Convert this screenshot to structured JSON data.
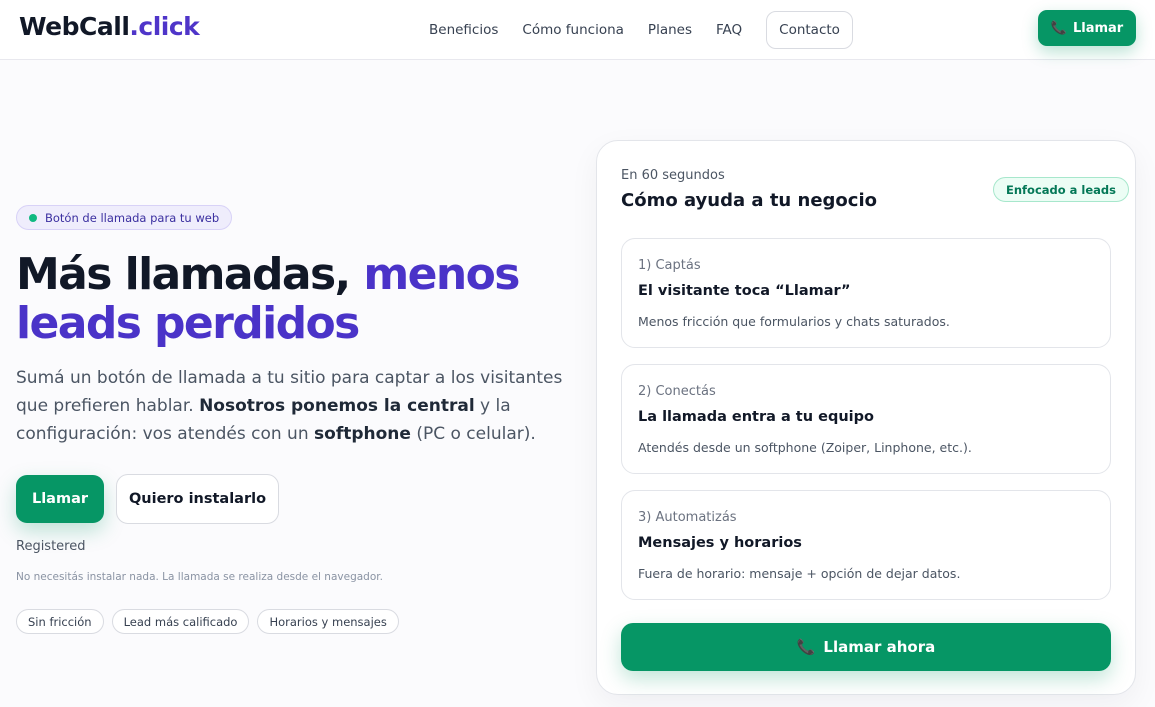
{
  "header": {
    "logo_main": "WebCall",
    "logo_accent": ".click",
    "nav": [
      "Beneficios",
      "Cómo funciona",
      "Planes",
      "FAQ"
    ],
    "contact": "Contacto",
    "call_label": "Llamar",
    "call_icon": "phone-icon"
  },
  "hero": {
    "pill": "Botón de llamada para tu web",
    "title_dark": "Más llamadas,",
    "title_purple": "menos leads perdidos",
    "lead_1": "Sumá un botón de llamada a tu sitio para captar a los visitantes que prefieren hablar. ",
    "lead_bold_1": "Nosotros ponemos la central",
    "lead_2": " y la configuración: vos atendés con un ",
    "lead_bold_2": "softphone",
    "lead_3": " (PC o celular).",
    "cta_call": "Llamar",
    "cta_install": "Quiero instalarlo",
    "status": "Registered",
    "note": "No necesitás instalar nada. La llamada se realiza desde el navegador.",
    "chips": [
      "Sin fricción",
      "Lead más calificado",
      "Horarios y mensajes"
    ]
  },
  "card": {
    "subtitle": "En 60 segundos",
    "title": "Cómo ayuda a tu negocio",
    "badge": "Enfocado a leads",
    "steps": [
      {
        "num": "1) Captás",
        "title": "El visitante toca “Llamar”",
        "desc": "Menos fricción que formularios y chats saturados."
      },
      {
        "num": "2) Conectás",
        "title": "La llamada entra a tu equipo",
        "desc": "Atendés desde un softphone (Zoiper, Linphone, etc.)."
      },
      {
        "num": "3) Automatizás",
        "title": "Mensajes y horarios",
        "desc": "Fuera de horario: mensaje + opción de dejar datos."
      }
    ],
    "call_now": "Llamar ahora"
  },
  "colors": {
    "brand_green": "#069665",
    "brand_purple": "#4a33c8",
    "phone_pink": "#ec4899"
  }
}
